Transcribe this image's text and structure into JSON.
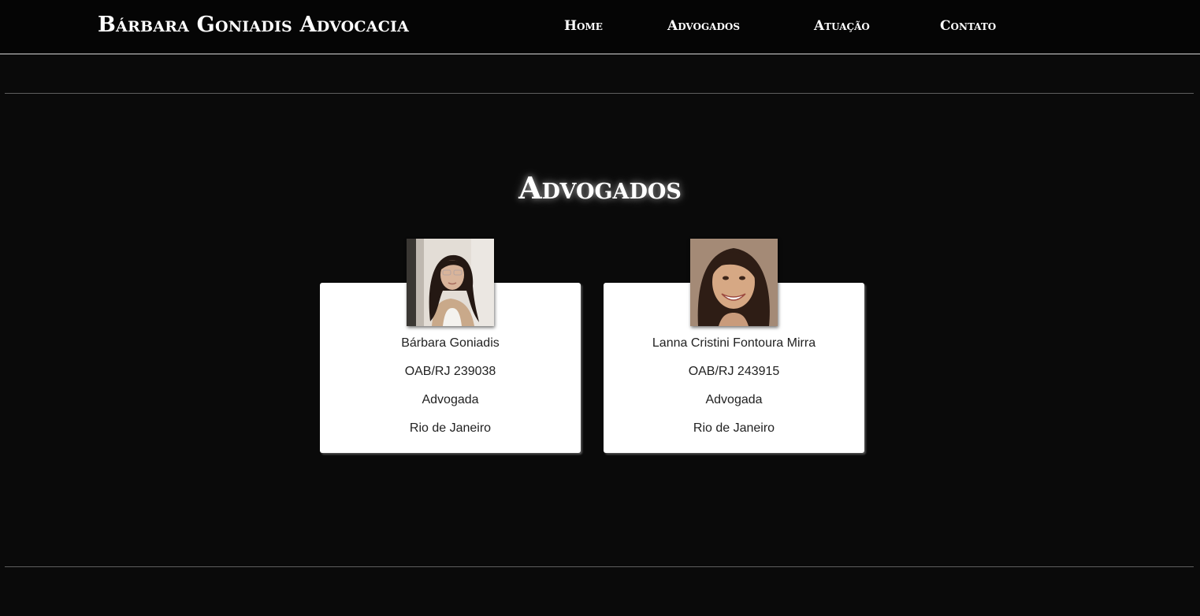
{
  "header": {
    "brand": "Bárbara Goniadis Advocacia",
    "nav": [
      {
        "label": "Home"
      },
      {
        "label": "Advogados"
      },
      {
        "label": "Atuação"
      },
      {
        "label": "Contato"
      }
    ]
  },
  "section": {
    "title": "Advogados"
  },
  "lawyers": [
    {
      "name": "Bárbara Goniadis",
      "oab": "OAB/RJ 239038",
      "role": "Advogada",
      "city": "Rio de Janeiro"
    },
    {
      "name": "Lanna Cristini Fontoura Mirra",
      "oab": "OAB/RJ 243915",
      "role": "Advogada",
      "city": "Rio de Janeiro"
    }
  ],
  "colors": {
    "page_background": "#0a0a0a",
    "header_background": "#050505",
    "card_background": "#ffffff",
    "text_light": "#ffffff",
    "text_dark": "#222222"
  }
}
